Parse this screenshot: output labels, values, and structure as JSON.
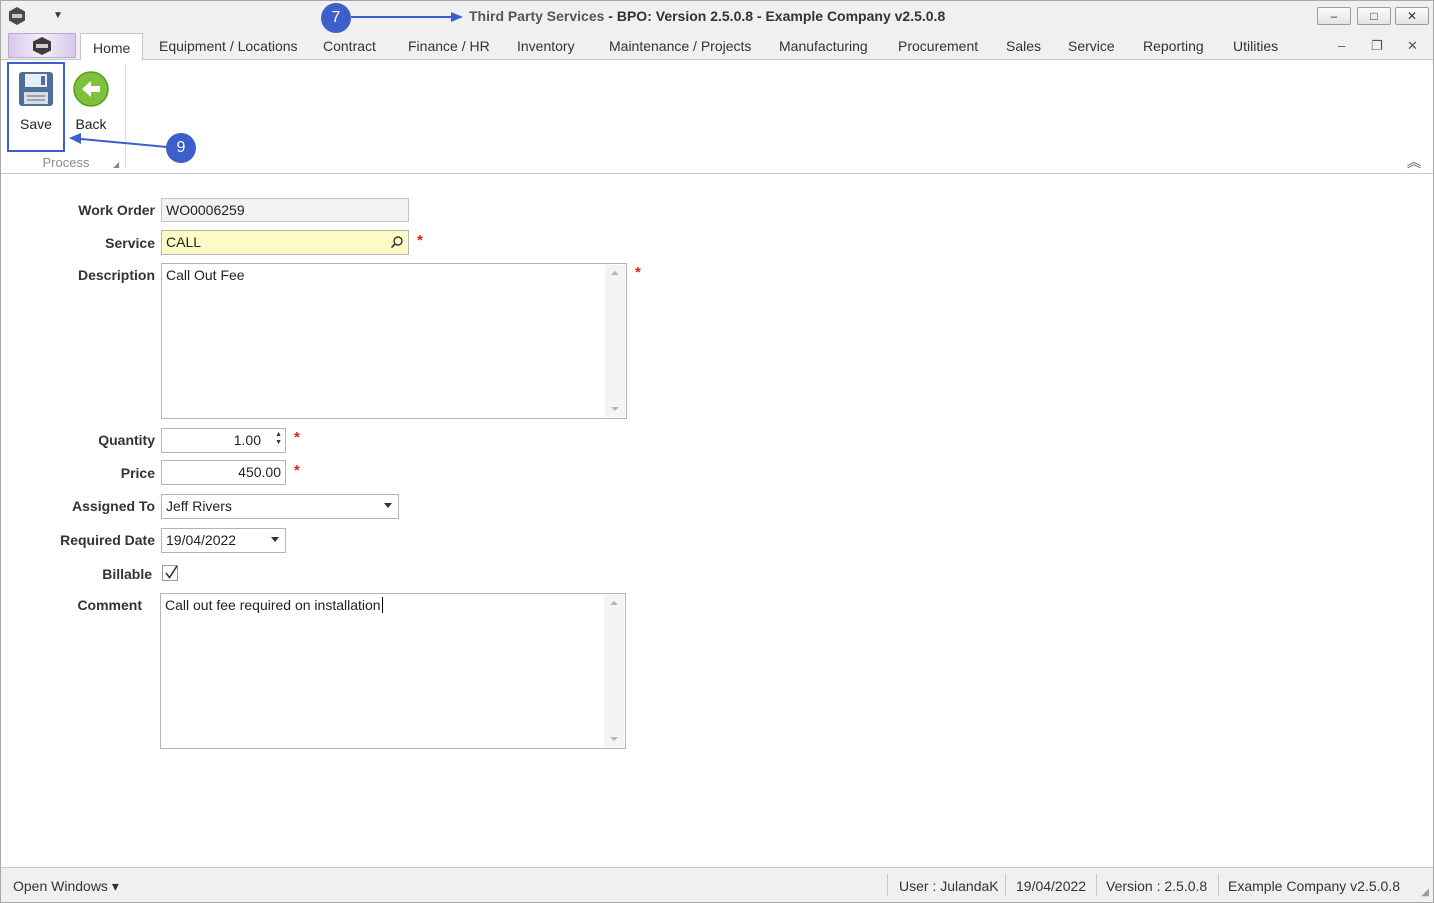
{
  "window": {
    "title_document": "Third Party Services",
    "title_app": "BPO: Version 2.5.0.8 - Example Company v2.5.0.8",
    "minimize": "–",
    "maximize": "□",
    "close": "✕"
  },
  "ribbon": {
    "tabs": [
      "Home",
      "Equipment / Locations",
      "Contract",
      "Finance / HR",
      "Inventory",
      "Maintenance / Projects",
      "Manufacturing",
      "Procurement",
      "Sales",
      "Service",
      "Reporting",
      "Utilities"
    ],
    "active_tab": "Home",
    "mdi_minimize": "–",
    "mdi_restore": "❐",
    "mdi_close": "✕",
    "buttons": {
      "save": "Save",
      "back": "Back"
    },
    "group_label": "Process",
    "collapse": "︽"
  },
  "annotations": {
    "callout_7": "7",
    "callout_9": "9"
  },
  "form": {
    "work_order": {
      "label": "Work Order",
      "value": "WO0006259"
    },
    "service": {
      "label": "Service",
      "value": "CALL"
    },
    "description": {
      "label": "Description",
      "value": "Call Out Fee"
    },
    "quantity": {
      "label": "Quantity",
      "value": "1.00"
    },
    "price": {
      "label": "Price",
      "value": "450.00"
    },
    "assigned_to": {
      "label": "Assigned To",
      "value": "Jeff Rivers"
    },
    "required_date": {
      "label": "Required Date",
      "value": "19/04/2022"
    },
    "billable": {
      "label": "Billable",
      "checked": true,
      "mark": "✓"
    },
    "comment": {
      "label": "Comment",
      "value": "Call out fee required on installation"
    },
    "required_mark": "*"
  },
  "statusbar": {
    "open_windows": "Open Windows ▾",
    "user": "User : JulandaK",
    "date": "19/04/2022",
    "version": "Version : 2.5.0.8",
    "company": "Example Company v2.5.0.8"
  },
  "colors": {
    "accent": "#3d5fc9",
    "required": "#e02020",
    "focus_bg": "#fdfcc6"
  }
}
